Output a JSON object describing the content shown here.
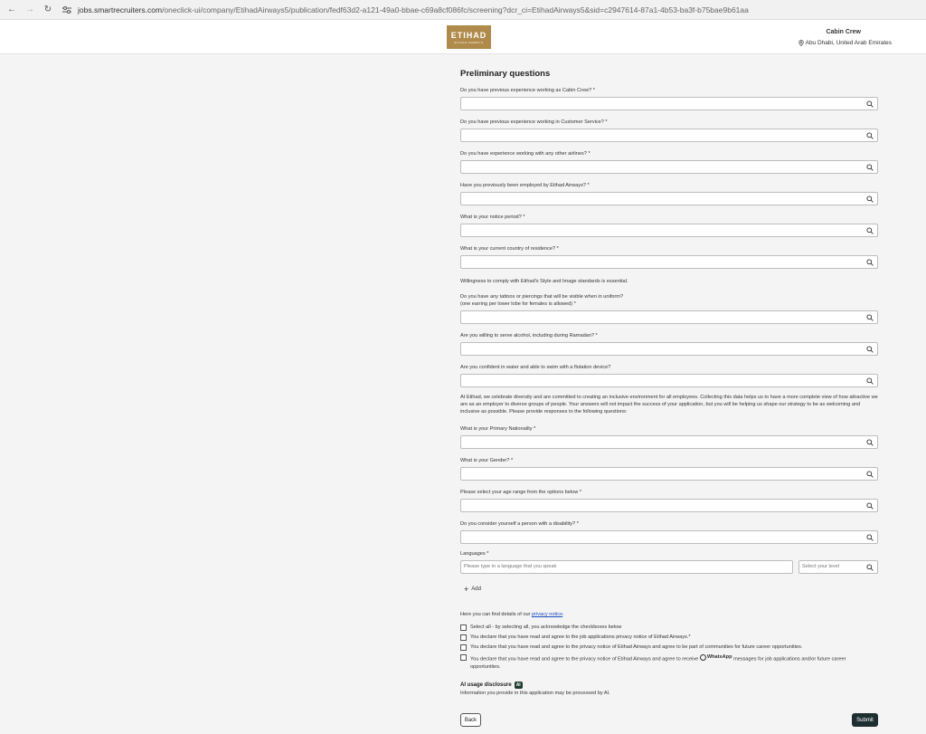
{
  "browser": {
    "url_domain": "jobs.smartrecruiters.com",
    "url_path": "/oneclick-ui/company/EtihadAirways5/publication/fedf63d2-a121-49a0-bbae-c69a8cf086fc/screening?dcr_ci=EtihadAirways5&sid=c2947614-87a1-4b53-ba3f-b75bae9b61aa"
  },
  "header": {
    "logo_text": "ETIHAD",
    "logo_sub": "ETIHAD AIRWAYS",
    "job_title": "Cabin Crew",
    "job_location": "Abu Dhabi, United Arab Emirates"
  },
  "form": {
    "title": "Preliminary questions",
    "questions": [
      {
        "label": "Do you have previous experience working as Cabin Crew? *"
      },
      {
        "label": "Do you have previous experience working in Customer Service? *"
      },
      {
        "label": "Do you have experience working with any other airlines? *"
      },
      {
        "label": "Have you previously been employed by Etihad Airways? *"
      },
      {
        "label": "What is your notice period? *"
      },
      {
        "label": "What is your current country of residence? *"
      }
    ],
    "style_note": "Willingness to comply with Etihad's Style and Image standards is essential.",
    "tattoo_q_line1": "Do you have any tattoos or piercings that will be visible when in uniform?",
    "tattoo_q_line2": "(one earring per lower lobe for females is allowed) *",
    "alcohol_q": "Are you willing to serve alcohol, including during Ramadan? *",
    "swim_q": "Are you confident in water and able to swim with a flotation device?",
    "diversity_text": "At Etihad, we celebrate diversity and are committed to creating an inclusive environment for all employees. Collecting this data helps us to have a more complete view of how attractive we are as an employer to diverse groups of people. Your answers will not impact the success of your application, but you will be helping us shape our strategy to be as welcoming and inclusive as possible. Please provide responses to the following questions:",
    "nationality_q": "What is your Primary Nationality *",
    "gender_q": "What is your Gender? *",
    "age_q": "Please select your age range from the options below *",
    "disability_q": "Do you consider yourself a person with a disability? *",
    "languages_label": "Languages *",
    "language_placeholder": "Please type in a language that you speak",
    "level_placeholder": "Select your level",
    "add_label": "Add",
    "privacy_prefix": "Here you can find details of our ",
    "privacy_link": "privacy notice",
    "privacy_suffix": ".",
    "checkboxes": {
      "select_all": "Select all - by selecting all, you acknowledge the checkboxes below",
      "privacy_agree": "You declare that you have read and agree to the job applications privacy notice of Etihad Airways.*",
      "community_agree": "You declare that you have read and agree to the privacy notice of Etihad Airways and agree to be part of communities for future career opportunities.",
      "whatsapp_prefix": "You declare that you have read and agree to the privacy notice of Etihad Airways and agree to receive ",
      "whatsapp_brand": "WhatsApp",
      "whatsapp_suffix": " messages for job applications and/or future career",
      "whatsapp_line2": "opportunities."
    },
    "ai_title": "AI usage disclosure",
    "ai_badge": "AI",
    "ai_text": "Information you provide in this application may be processed by AI.",
    "back_label": "Back",
    "submit_label": "Submit"
  }
}
